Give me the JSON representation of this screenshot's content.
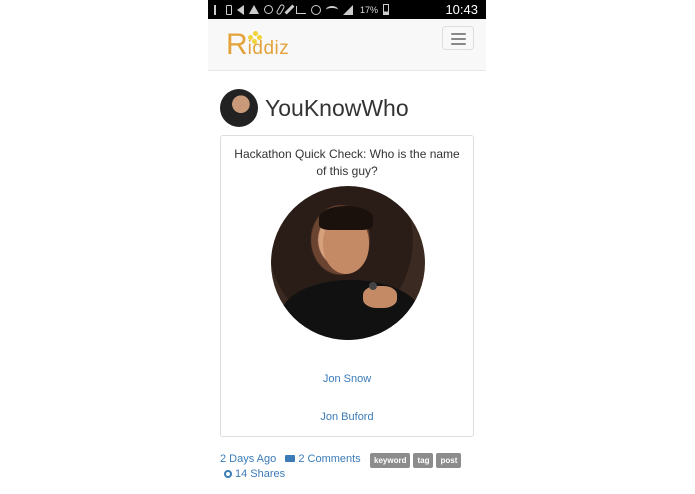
{
  "statusbar": {
    "battery": "17%",
    "time": "10:43"
  },
  "brand": {
    "logo_initial": "R",
    "logo_rest": "iddiz",
    "accent": "#e3a33a"
  },
  "user": {
    "name": "YouKnowWho"
  },
  "card": {
    "question": "Hackathon Quick Check: Who is the name of this guy?",
    "answers": [
      "Jon Snow",
      "Jon Buford"
    ]
  },
  "meta": {
    "time_ago": "2 Days Ago",
    "comments": "2 Comments",
    "shares": "14 Shares",
    "tags": [
      "keyword",
      "tag",
      "post"
    ],
    "link_color": "#3a7bb8"
  }
}
